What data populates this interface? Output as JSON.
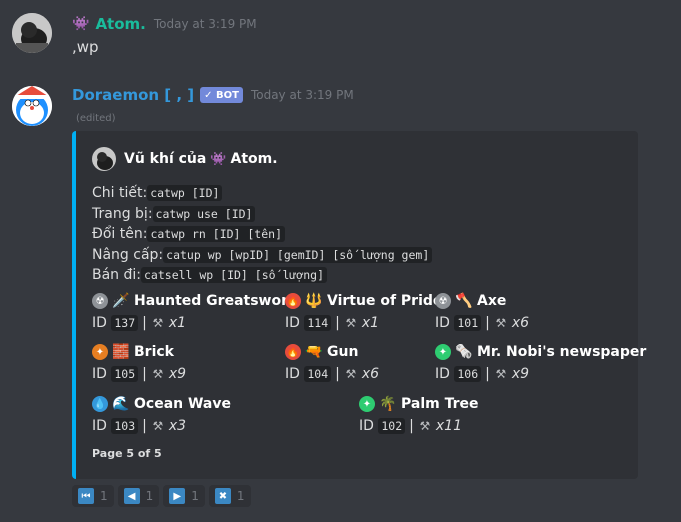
{
  "msg1": {
    "emoji": "👾",
    "author": "Atom.",
    "timestamp": "Today at 3:19 PM",
    "text": ",wp"
  },
  "msg2": {
    "author": "Doraemon [ , ]",
    "bot_badge": "✓ BOT",
    "timestamp": "Today at 3:19 PM",
    "edited": "(edited)"
  },
  "embed": {
    "author_prefix": "Vũ khí của",
    "author_emoji": "👾",
    "author_name": "Atom.",
    "lines": [
      {
        "label": "Chi tiết:",
        "code": "catwp [ID]"
      },
      {
        "label": "Trang bị:",
        "code": "catwp use [ID]"
      },
      {
        "label": "Đổi tên:",
        "code": "catwp rn [ID] [tên]"
      },
      {
        "label": "Nâng cấp:",
        "code": "catup wp [wpID] [gemID] [số lượng gem]"
      },
      {
        "label": "Bán đi:",
        "code": "catsell wp [ID] [số lượng]"
      }
    ],
    "weapons": [
      {
        "name": "Haunted Greatsword",
        "id": "137",
        "count": "x1",
        "weapon_icon": "🗡️",
        "rarity_icon": "☢",
        "rarity_color": "#8e9297"
      },
      {
        "name": "Virtue of Pride",
        "id": "114",
        "count": "x1",
        "weapon_icon": "🔱",
        "rarity_icon": "🔥",
        "rarity_color": "#e74c3c"
      },
      {
        "name": "Axe",
        "id": "101",
        "count": "x6",
        "weapon_icon": "🪓",
        "rarity_icon": "☢",
        "rarity_color": "#8e9297"
      },
      {
        "name": "Brick",
        "id": "105",
        "count": "x9",
        "weapon_icon": "🧱",
        "rarity_icon": "✦",
        "rarity_color": "#e67e22"
      },
      {
        "name": "Gun",
        "id": "104",
        "count": "x6",
        "weapon_icon": "🔫",
        "rarity_icon": "🔥",
        "rarity_color": "#e74c3c"
      },
      {
        "name": "Mr. Nobi's newspaper",
        "id": "106",
        "count": "x9",
        "weapon_icon": "🗞️",
        "rarity_icon": "✦",
        "rarity_color": "#2ecc71"
      },
      {
        "name": "Ocean Wave",
        "id": "103",
        "count": "x3",
        "weapon_icon": "🌊",
        "rarity_icon": "💧",
        "rarity_color": "#3498db"
      },
      {
        "name": "Palm Tree",
        "id": "102",
        "count": "x11",
        "weapon_icon": "🌴",
        "rarity_icon": "✦",
        "rarity_color": "#2ecc71"
      }
    ],
    "id_label": "ID",
    "pipe": "|",
    "footer": "Page 5 of 5"
  },
  "reactions": [
    {
      "icon": "⏮",
      "count": "1",
      "name": "first-page-reaction"
    },
    {
      "icon": "◀",
      "count": "1",
      "name": "prev-page-reaction"
    },
    {
      "icon": "▶",
      "count": "1",
      "name": "next-page-reaction"
    },
    {
      "icon": "✖",
      "count": "1",
      "name": "close-reaction"
    }
  ],
  "colors": {
    "atom_name": "#1abc9c",
    "doraemon_name": "#3498db",
    "embed_border": "#00b0f4",
    "bot_badge": "#7289da"
  }
}
